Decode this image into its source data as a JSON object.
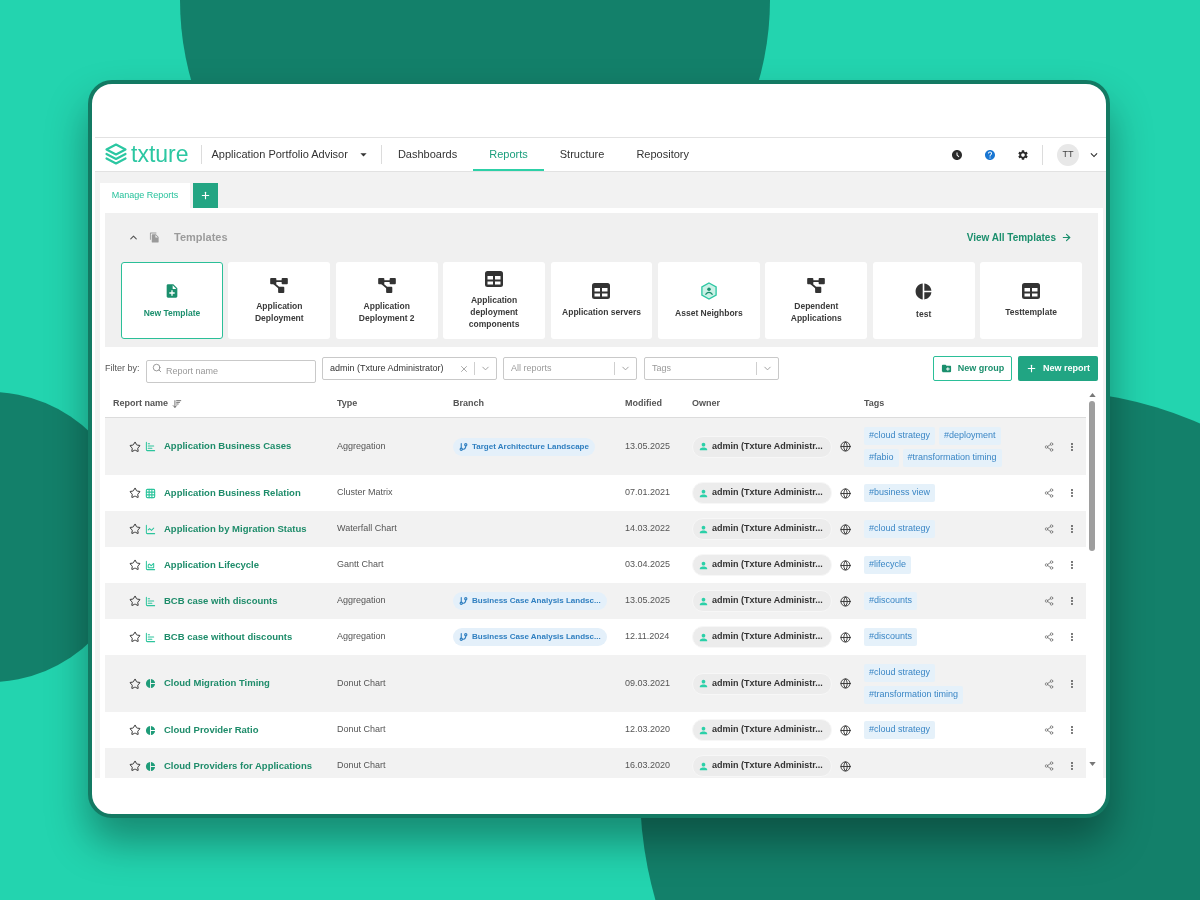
{
  "header": {
    "logo": "txture",
    "product": "Application Portfolio Advisor",
    "nav": [
      {
        "label": "Dashboards",
        "selected": false
      },
      {
        "label": "Reports",
        "selected": true
      },
      {
        "label": "Structure",
        "selected": false
      },
      {
        "label": "Repository",
        "selected": false
      }
    ],
    "avatar": "TT"
  },
  "tabs": [
    {
      "label": "Manage Reports",
      "selected": true
    }
  ],
  "templates": {
    "title": "Templates",
    "expanded": true,
    "view_all": "View All Templates",
    "items": [
      {
        "label": "New Template",
        "kind": "new"
      },
      {
        "label": "Application Deployment",
        "kind": "flow"
      },
      {
        "label": "Application Deployment 2",
        "kind": "flow"
      },
      {
        "label": "Application deployment components",
        "kind": "table"
      },
      {
        "label": "Application servers",
        "kind": "table"
      },
      {
        "label": "Asset Neighbors",
        "kind": "neighbors"
      },
      {
        "label": "Dependent Applications",
        "kind": "flow"
      },
      {
        "label": "test",
        "kind": "pie"
      },
      {
        "label": "Testtemplate",
        "kind": "table"
      }
    ]
  },
  "filters": {
    "label": "Filter by:",
    "search": {
      "placeholder": "Report name"
    },
    "owner": {
      "value": "admin (Txture Administrator)"
    },
    "scope": {
      "placeholder": "All reports"
    },
    "tags": {
      "placeholder": "Tags"
    }
  },
  "actions": [
    {
      "label": "New group",
      "kind": "outline"
    },
    {
      "label": "New report",
      "kind": "primary"
    }
  ],
  "table": {
    "columns": [
      {
        "label": "Report name",
        "sorted": true
      },
      {
        "label": "Type",
        "sorted": false
      },
      {
        "label": "Branch",
        "sorted": false
      },
      {
        "label": "Modified",
        "sorted": false
      },
      {
        "label": "Owner",
        "sorted": false
      },
      {
        "label": "Tags",
        "sorted": false
      }
    ],
    "rows": [
      {
        "name": "Application Business Cases",
        "kind": "aggregation",
        "favorite": false,
        "type": "Aggregation",
        "branch": "Target Architecture Landscape",
        "modified": "13.05.2025",
        "owner": "admin (Txture Administr...",
        "tags": [
          "#cloud strategy",
          "#deployment",
          "#fabio",
          "#transformation timing"
        ]
      },
      {
        "name": "Application Business Relation",
        "kind": "matrix",
        "favorite": false,
        "type": "Cluster Matrix",
        "modified": "07.01.2021",
        "owner": "admin (Txture Administr...",
        "tags": [
          "#business view"
        ]
      },
      {
        "name": "Application by Migration Status",
        "kind": "waterfall",
        "favorite": false,
        "type": "Waterfall Chart",
        "modified": "14.03.2022",
        "owner": "admin (Txture Administr...",
        "tags": [
          "#cloud strategy"
        ]
      },
      {
        "name": "Application Lifecycle",
        "kind": "gantt",
        "favorite": false,
        "type": "Gantt Chart",
        "modified": "03.04.2025",
        "owner": "admin (Txture Administr...",
        "tags": [
          "#lifecycle"
        ]
      },
      {
        "name": "BCB case with discounts",
        "kind": "aggregation",
        "favorite": false,
        "type": "Aggregation",
        "branch": "Business Case Analysis Landsc...",
        "modified": "13.05.2025",
        "owner": "admin (Txture Administr...",
        "tags": [
          "#discounts"
        ]
      },
      {
        "name": "BCB case without discounts",
        "kind": "aggregation",
        "favorite": false,
        "type": "Aggregation",
        "branch": "Business Case Analysis Landsc...",
        "modified": "12.11.2024",
        "owner": "admin (Txture Administr...",
        "tags": [
          "#discounts"
        ]
      },
      {
        "name": "Cloud Migration Timing",
        "kind": "donut",
        "favorite": false,
        "type": "Donut Chart",
        "modified": "09.03.2021",
        "owner": "admin (Txture Administr...",
        "tags": [
          "#cloud strategy",
          "#transformation timing"
        ]
      },
      {
        "name": "Cloud Provider Ratio",
        "kind": "donut",
        "favorite": false,
        "type": "Donut Chart",
        "modified": "12.03.2020",
        "owner": "admin (Txture Administr...",
        "tags": [
          "#cloud strategy"
        ]
      },
      {
        "name": "Cloud Providers for Applications",
        "kind": "donut",
        "favorite": false,
        "type": "Donut Chart",
        "modified": "16.03.2020",
        "owner": "admin (Txture Administr..."
      }
    ]
  }
}
